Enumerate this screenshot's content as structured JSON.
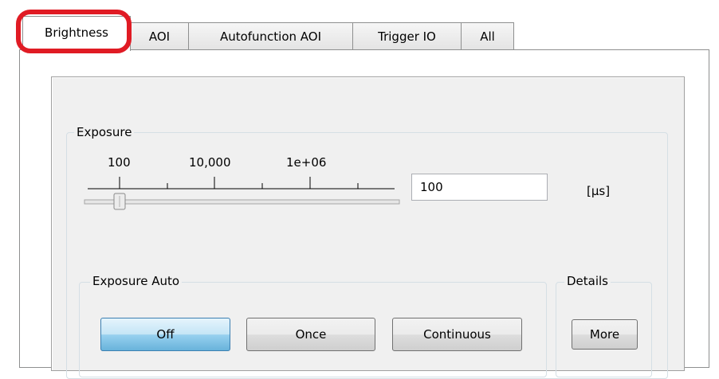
{
  "tabs": [
    {
      "label": "Brightness",
      "active": true
    },
    {
      "label": "AOI",
      "active": false
    },
    {
      "label": "Autofunction AOI",
      "active": false
    },
    {
      "label": "Trigger IO",
      "active": false
    },
    {
      "label": "All",
      "active": false
    }
  ],
  "exposure": {
    "title": "Exposure",
    "tick_labels": [
      "100",
      "10,000",
      "1e+06"
    ],
    "value": "100",
    "unit": "[µs]"
  },
  "exposure_auto": {
    "title": "Exposure Auto",
    "buttons": {
      "off": "Off",
      "once": "Once",
      "continuous": "Continuous"
    },
    "selected": "Off"
  },
  "details": {
    "title": "Details",
    "more_label": "More"
  },
  "colors": {
    "highlight": "#e01b24",
    "pressed_button": "#98d1ef"
  }
}
